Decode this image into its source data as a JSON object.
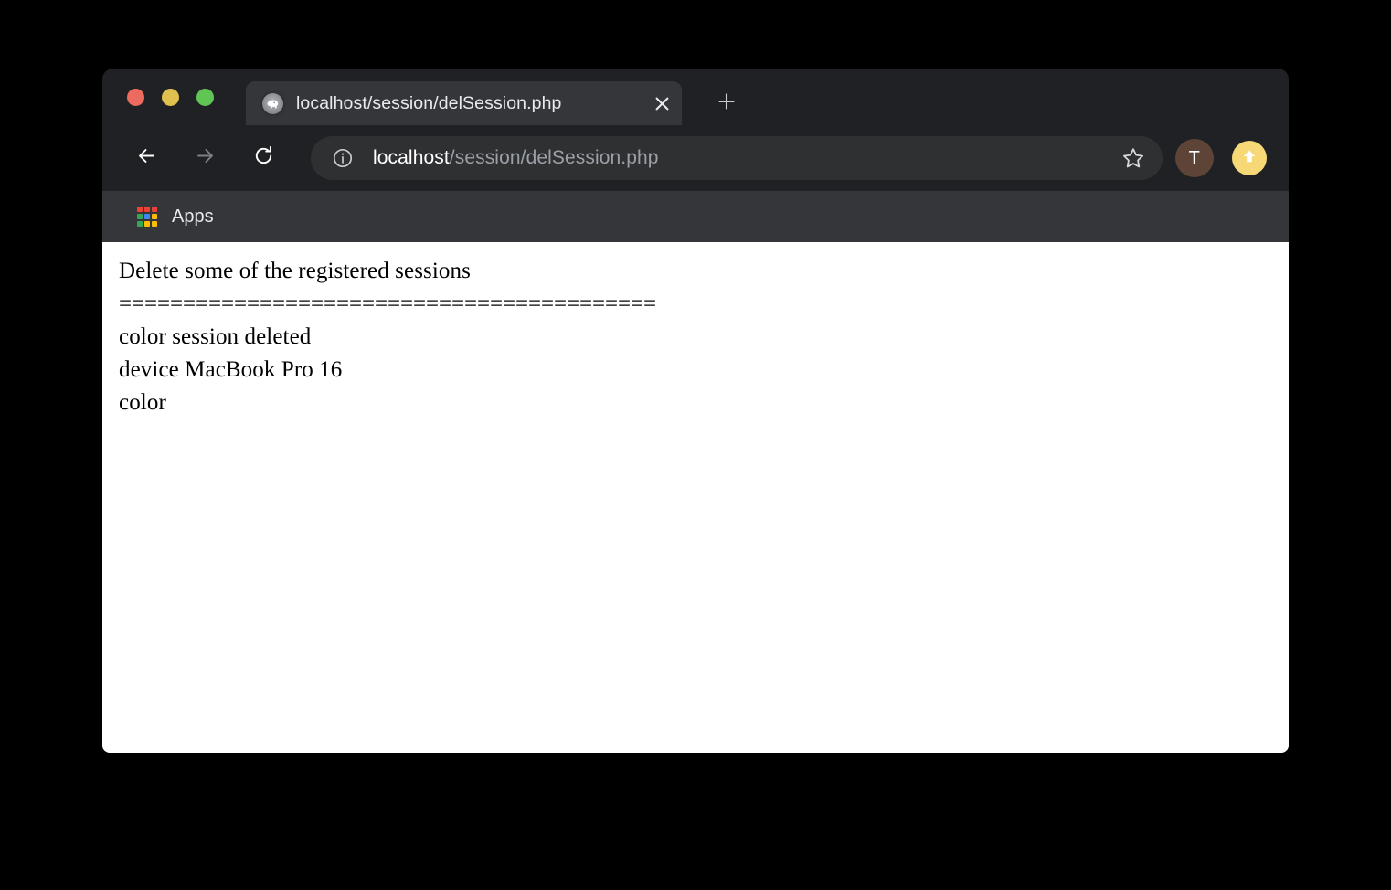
{
  "window": {
    "traffic_lights": [
      {
        "name": "close",
        "color": "#ec6a5e"
      },
      {
        "name": "minimize",
        "color": "#e0c150"
      },
      {
        "name": "maximize",
        "color": "#61c555"
      }
    ]
  },
  "tab": {
    "title": "localhost/session/delSession.php",
    "favicon": "php-elephant-icon",
    "close_icon": "close-icon",
    "new_tab_icon": "plus-icon"
  },
  "toolbar": {
    "back_icon": "back-arrow-icon",
    "forward_icon": "forward-arrow-icon",
    "reload_icon": "reload-icon",
    "info_icon": "info-circle-icon",
    "url_host": "localhost",
    "url_path": "/session/delSession.php",
    "url_full": "localhost/session/delSession.php",
    "star_icon": "star-bookmark-icon",
    "avatar_initial": "T",
    "avatar_color": "#5d4436",
    "update_icon": "update-arrow-up-icon",
    "update_color": "#f6d976"
  },
  "bookmarks": {
    "apps_label": "Apps",
    "apps_icon": "apps-grid-icon",
    "apps_grid_colors": [
      "#ea4335",
      "#ea4335",
      "#ea4335",
      "#34a853",
      "#4285f4",
      "#fbbc05",
      "#34a853",
      "#fbbc05",
      "#fbbc05"
    ]
  },
  "page": {
    "heading": "Delete some of the registered sessions",
    "divider": "==========================================",
    "lines": [
      "color session deleted",
      "device MacBook Pro 16",
      "color"
    ]
  }
}
